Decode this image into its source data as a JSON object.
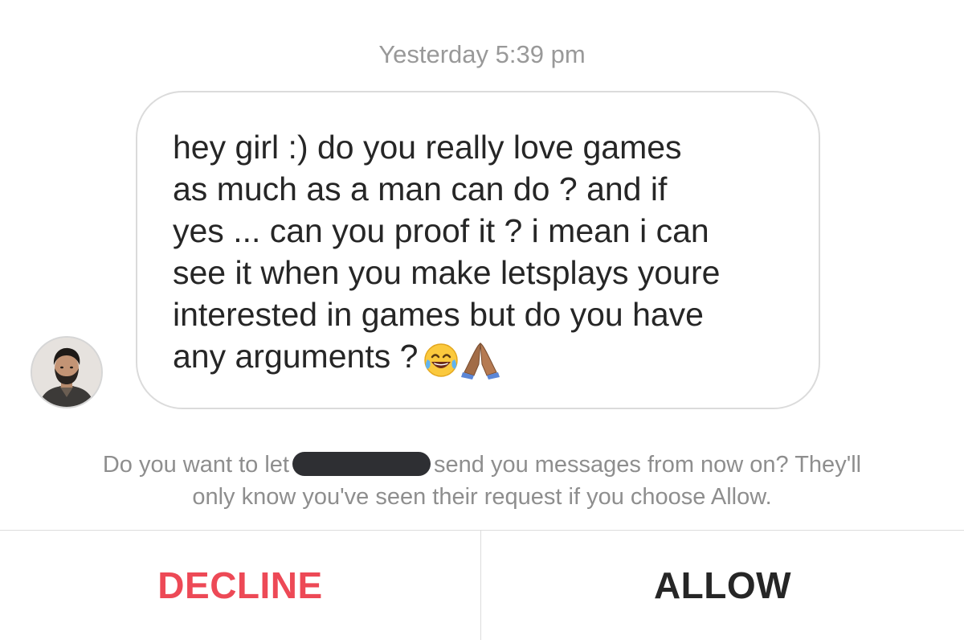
{
  "thread": {
    "timestamp": "Yesterday 5:39 pm"
  },
  "message": {
    "lines": [
      "hey girl :) do you really love games",
      "as much as a man can do ? and if",
      "yes ... can you proof it ? i mean i can",
      "see it when you make letsplays youre",
      "interested in games but do you have",
      "any arguments ?"
    ],
    "emojis": [
      "face-with-tears-of-joy-icon",
      "folded-hands-icon"
    ]
  },
  "request": {
    "text_before": "Do you want to let",
    "text_after": "send you messages from now on? They'll",
    "text_line2": "only know you've seen their request if you choose Allow."
  },
  "actions": {
    "decline_label": "DECLINE",
    "allow_label": "ALLOW"
  },
  "colors": {
    "decline": "#ed4956",
    "allow": "#262626",
    "muted_text": "#8e8e8e",
    "bubble_border": "#dbdbdb"
  }
}
